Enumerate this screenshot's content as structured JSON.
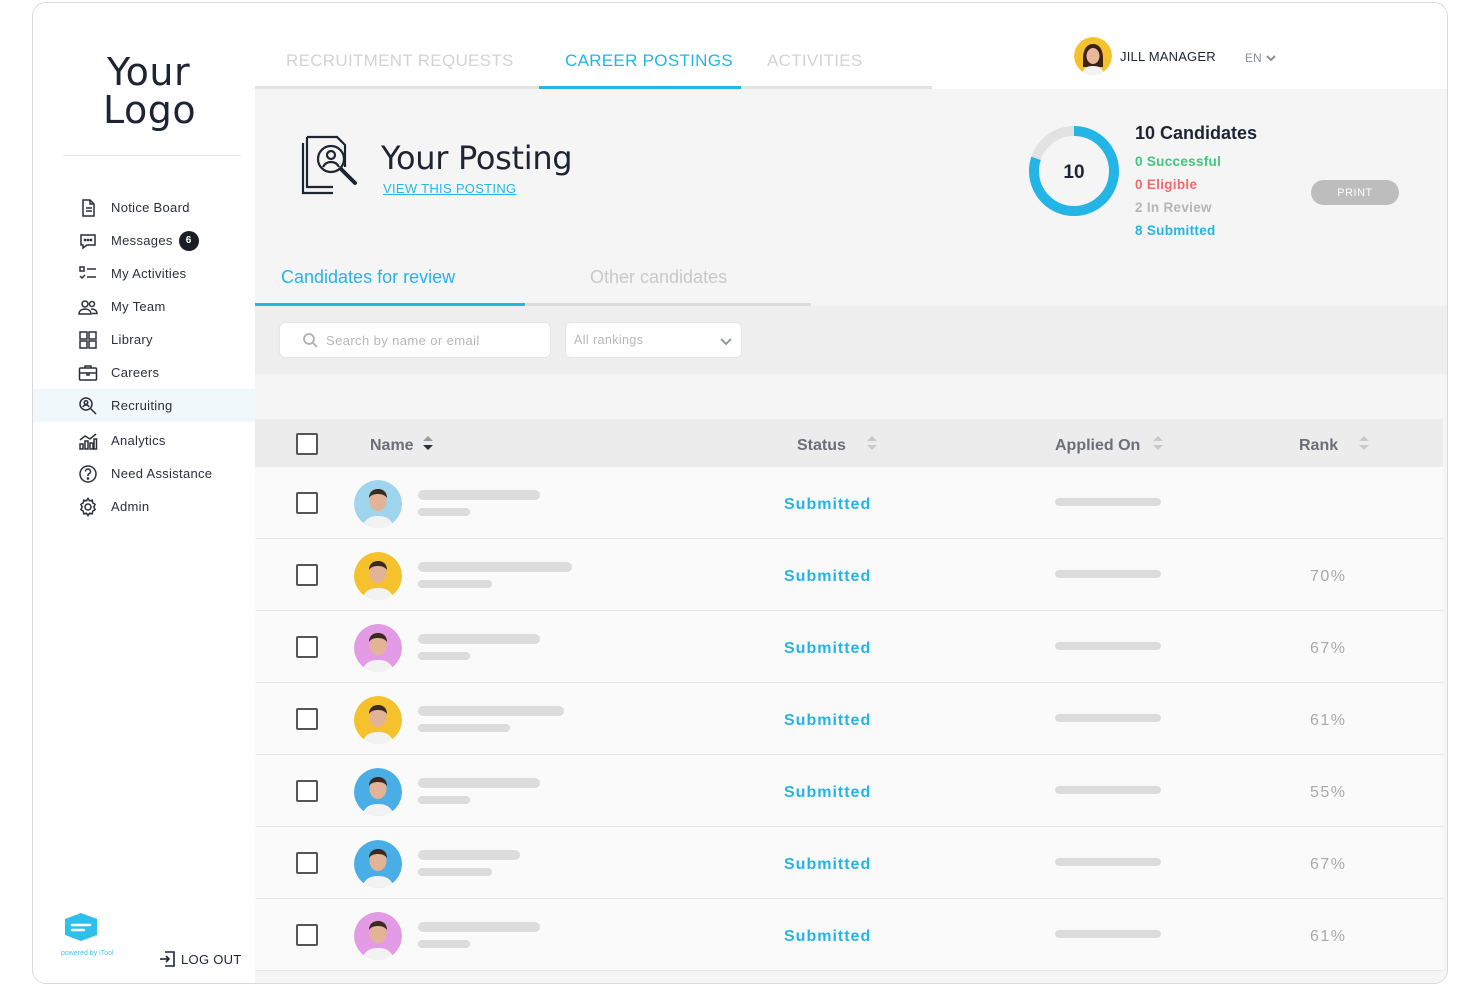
{
  "brand": {
    "logo_line1": "Your",
    "logo_line2": "Logo",
    "powered_by": "powered by iTool"
  },
  "sidebar": {
    "items": [
      {
        "label": "Notice Board",
        "icon": "document-icon"
      },
      {
        "label": "Messages",
        "icon": "chat-icon",
        "badge": "6"
      },
      {
        "label": "My Activities",
        "icon": "checklist-icon"
      },
      {
        "label": "My Team",
        "icon": "team-icon"
      },
      {
        "label": "Library",
        "icon": "grid-icon"
      },
      {
        "label": "Careers",
        "icon": "briefcase-icon"
      },
      {
        "label": "Recruiting",
        "icon": "search-person-icon",
        "active": true
      },
      {
        "label": "Analytics",
        "icon": "analytics-icon"
      },
      {
        "label": "Need Assistance",
        "icon": "help-icon"
      },
      {
        "label": "Admin",
        "icon": "gear-icon"
      }
    ],
    "logout_label": "LOG OUT"
  },
  "topbar": {
    "tabs": [
      {
        "label": "RECRUITMENT REQUESTS"
      },
      {
        "label": "CAREER POSTINGS",
        "active": true
      },
      {
        "label": "ACTIVITIES"
      }
    ],
    "user_name": "JILL MANAGER",
    "language": "EN"
  },
  "posting": {
    "title": "Your Posting",
    "view_link": "VIEW THIS POSTING",
    "print_label": "PRINT"
  },
  "candidates_summary": {
    "total": "10",
    "title": "10 Candidates",
    "successful": "0 Successful",
    "eligible": "0 Eligible",
    "in_review": "2 In Review",
    "submitted": "8 Submitted",
    "submitted_fraction": 0.8,
    "colors": {
      "successful": "#3ec77a",
      "eligible": "#ef6a6a",
      "in_review": "#b5b5b5",
      "submitted": "#23b5e6",
      "ring_track": "#e2e2e2"
    }
  },
  "subtabs": [
    {
      "label": "Candidates for review",
      "active": true
    },
    {
      "label": "Other candidates"
    }
  ],
  "filters": {
    "search_placeholder": "Search by name or email",
    "ranking_selected": "All rankings"
  },
  "table": {
    "headers": {
      "name": "Name",
      "status": "Status",
      "applied_on": "Applied On",
      "rank": "Rank"
    },
    "rows": [
      {
        "status": "Submitted",
        "rank": "",
        "avatar_bg": "#9fd4ef"
      },
      {
        "status": "Submitted",
        "rank": "70%",
        "avatar_bg": "#f5c22e"
      },
      {
        "status": "Submitted",
        "rank": "67%",
        "avatar_bg": "#e39be6"
      },
      {
        "status": "Submitted",
        "rank": "61%",
        "avatar_bg": "#f5c22e"
      },
      {
        "status": "Submitted",
        "rank": "55%",
        "avatar_bg": "#4aaee6"
      },
      {
        "status": "Submitted",
        "rank": "67%",
        "avatar_bg": "#4aaee6"
      },
      {
        "status": "Submitted",
        "rank": "61%",
        "avatar_bg": "#e39be6"
      }
    ]
  },
  "accent_color": "#23b5e6"
}
